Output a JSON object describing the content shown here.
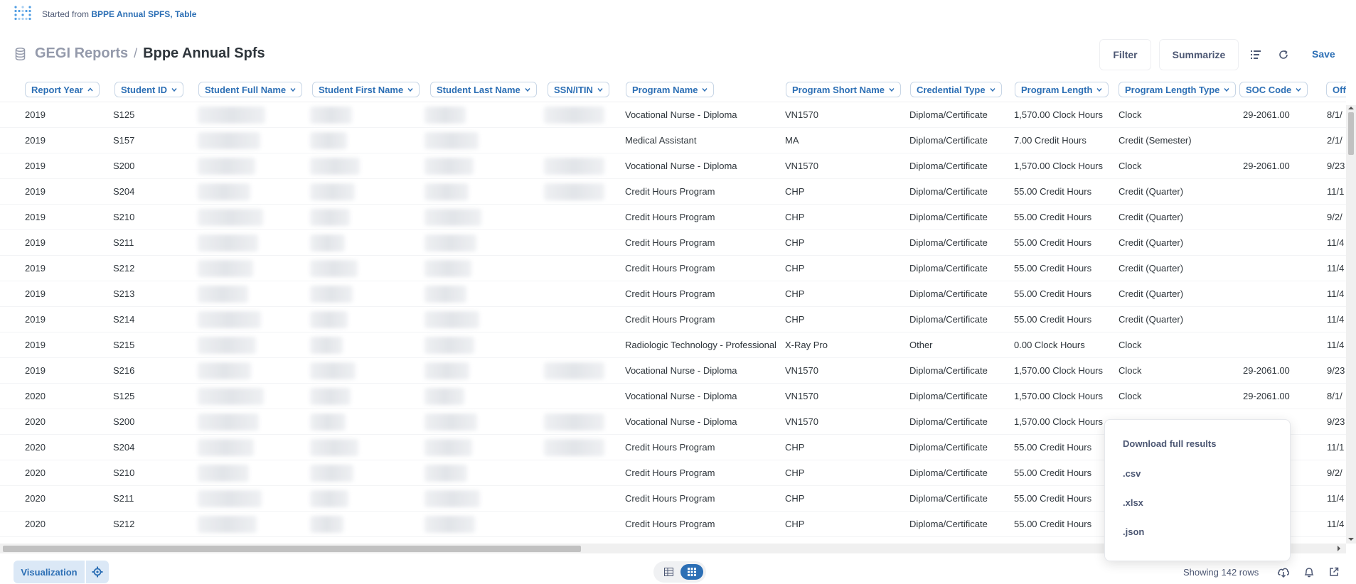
{
  "topbar": {
    "started_prefix": "Started from",
    "started_link": "BPPE Annual SPFS, Table"
  },
  "header": {
    "breadcrumb_root": "GEGI Reports",
    "breadcrumb_sep": "/",
    "title": "Bppe Annual Spfs",
    "filter_label": "Filter",
    "summarize_label": "Summarize",
    "save_label": "Save"
  },
  "columns": [
    "Report Year",
    "Student ID",
    "Student Full Name",
    "Student First Name",
    "Student Last Name",
    "SSN/ITIN",
    "Program Name",
    "Program Short Name",
    "Credential Type",
    "Program Length",
    "Program Length Type",
    "SOC Code",
    "Offici"
  ],
  "rows": [
    {
      "year": "2019",
      "id": "S125",
      "program": "Vocational Nurse - Diploma",
      "short": "VN1570",
      "cred": "Diploma/Certificate",
      "length": "1,570.00 Clock Hours",
      "ltype": "Clock",
      "soc": "29-2061.00",
      "off": "8/1/"
    },
    {
      "year": "2019",
      "id": "S157",
      "program": "Medical Assistant",
      "short": "MA",
      "cred": "Diploma/Certificate",
      "length": "7.00 Credit Hours",
      "ltype": "Credit (Semester)",
      "soc": "",
      "off": "2/1/"
    },
    {
      "year": "2019",
      "id": "S200",
      "program": "Vocational Nurse - Diploma",
      "short": "VN1570",
      "cred": "Diploma/Certificate",
      "length": "1,570.00 Clock Hours",
      "ltype": "Clock",
      "soc": "29-2061.00",
      "off": "9/23"
    },
    {
      "year": "2019",
      "id": "S204",
      "program": "Credit Hours Program",
      "short": "CHP",
      "cred": "Diploma/Certificate",
      "length": "55.00 Credit Hours",
      "ltype": "Credit (Quarter)",
      "soc": "",
      "off": "11/1"
    },
    {
      "year": "2019",
      "id": "S210",
      "program": "Credit Hours Program",
      "short": "CHP",
      "cred": "Diploma/Certificate",
      "length": "55.00 Credit Hours",
      "ltype": "Credit (Quarter)",
      "soc": "",
      "off": "9/2/"
    },
    {
      "year": "2019",
      "id": "S211",
      "program": "Credit Hours Program",
      "short": "CHP",
      "cred": "Diploma/Certificate",
      "length": "55.00 Credit Hours",
      "ltype": "Credit (Quarter)",
      "soc": "",
      "off": "11/4"
    },
    {
      "year": "2019",
      "id": "S212",
      "program": "Credit Hours Program",
      "short": "CHP",
      "cred": "Diploma/Certificate",
      "length": "55.00 Credit Hours",
      "ltype": "Credit (Quarter)",
      "soc": "",
      "off": "11/4"
    },
    {
      "year": "2019",
      "id": "S213",
      "program": "Credit Hours Program",
      "short": "CHP",
      "cred": "Diploma/Certificate",
      "length": "55.00 Credit Hours",
      "ltype": "Credit (Quarter)",
      "soc": "",
      "off": "11/4"
    },
    {
      "year": "2019",
      "id": "S214",
      "program": "Credit Hours Program",
      "short": "CHP",
      "cred": "Diploma/Certificate",
      "length": "55.00 Credit Hours",
      "ltype": "Credit (Quarter)",
      "soc": "",
      "off": "11/4"
    },
    {
      "year": "2019",
      "id": "S215",
      "program": "Radiologic Technology - Professional",
      "short": "X-Ray Pro",
      "cred": "Other",
      "length": "0.00 Clock Hours",
      "ltype": "Clock",
      "soc": "",
      "off": "11/4"
    },
    {
      "year": "2019",
      "id": "S216",
      "program": "Vocational Nurse - Diploma",
      "short": "VN1570",
      "cred": "Diploma/Certificate",
      "length": "1,570.00 Clock Hours",
      "ltype": "Clock",
      "soc": "29-2061.00",
      "off": "9/23"
    },
    {
      "year": "2020",
      "id": "S125",
      "program": "Vocational Nurse - Diploma",
      "short": "VN1570",
      "cred": "Diploma/Certificate",
      "length": "1,570.00 Clock Hours",
      "ltype": "Clock",
      "soc": "29-2061.00",
      "off": "8/1/"
    },
    {
      "year": "2020",
      "id": "S200",
      "program": "Vocational Nurse - Diploma",
      "short": "VN1570",
      "cred": "Diploma/Certificate",
      "length": "1,570.00 Clock Hours",
      "ltype": "",
      "soc": "",
      "off": "9/23"
    },
    {
      "year": "2020",
      "id": "S204",
      "program": "Credit Hours Program",
      "short": "CHP",
      "cred": "Diploma/Certificate",
      "length": "55.00 Credit Hours",
      "ltype": "",
      "soc": "",
      "off": "11/1"
    },
    {
      "year": "2020",
      "id": "S210",
      "program": "Credit Hours Program",
      "short": "CHP",
      "cred": "Diploma/Certificate",
      "length": "55.00 Credit Hours",
      "ltype": "",
      "soc": "",
      "off": "9/2/"
    },
    {
      "year": "2020",
      "id": "S211",
      "program": "Credit Hours Program",
      "short": "CHP",
      "cred": "Diploma/Certificate",
      "length": "55.00 Credit Hours",
      "ltype": "",
      "soc": "",
      "off": "11/4"
    },
    {
      "year": "2020",
      "id": "S212",
      "program": "Credit Hours Program",
      "short": "CHP",
      "cred": "Diploma/Certificate",
      "length": "55.00 Credit Hours",
      "ltype": "",
      "soc": "",
      "off": "11/4"
    }
  ],
  "download_popover": {
    "title": "Download full results",
    "options": [
      ".csv",
      ".xlsx",
      ".json"
    ]
  },
  "footer": {
    "visualization_label": "Visualization",
    "row_count": "Showing 142 rows"
  },
  "icons": {
    "logo": "metabase-logo-icon",
    "database": "database-icon",
    "filter_list": "list-icon",
    "refresh": "refresh-icon",
    "gear": "gear-icon",
    "download": "download-icon",
    "bell": "bell-icon",
    "share": "external-link-icon"
  },
  "colors": {
    "accent": "#2c6fb5",
    "text": "#4c5773",
    "dark_text": "#2e353b",
    "viz_bg": "#dbe8f6"
  }
}
